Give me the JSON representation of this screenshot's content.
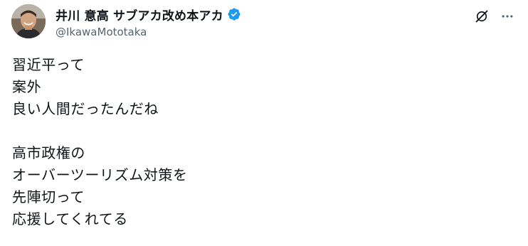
{
  "post": {
    "author": {
      "display_name": "井川 意高 サブアカ改め本アカ",
      "handle": "@IkawaMototaka",
      "verified": true,
      "avatar_icon": "user-avatar"
    },
    "actions": {
      "grok_icon": "grok-icon",
      "more_icon": "more-dots-icon"
    },
    "text": {
      "paragraph1": [
        "習近平って",
        "案外",
        "良い人間だったんだね"
      ],
      "paragraph2": [
        "高市政権の",
        "オーバーツーリズム対策を",
        "先陣切って",
        "応援してくれてる"
      ]
    }
  },
  "colors": {
    "text": "#0f1419",
    "secondary": "#536471",
    "verified_badge": "#1d9bf0"
  }
}
